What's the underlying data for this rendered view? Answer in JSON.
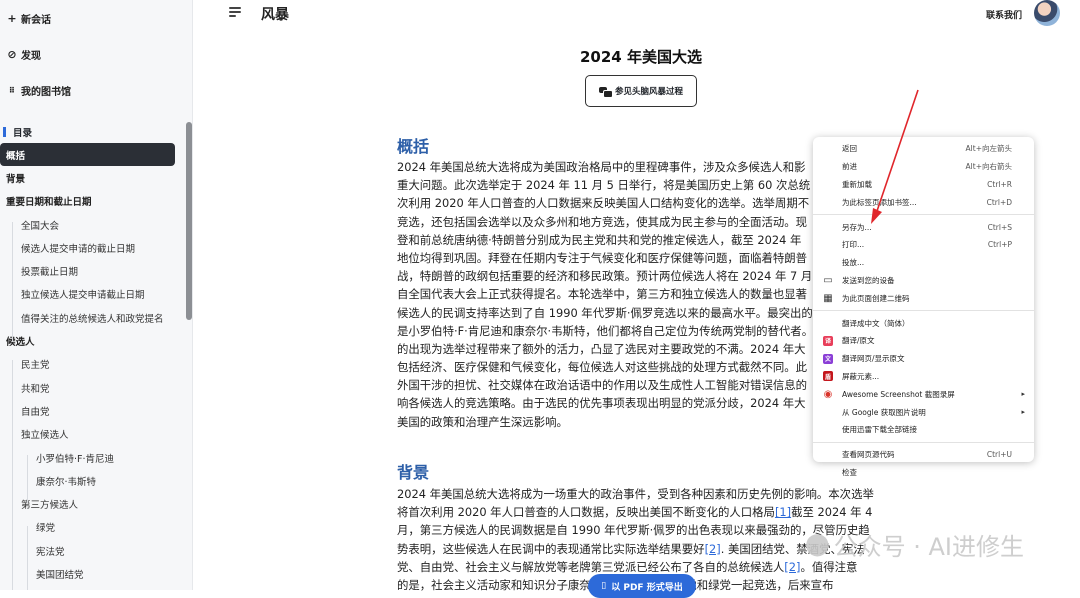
{
  "sidebar": {
    "new_chat": "新会话",
    "discover": "发现",
    "library": "我的图书馆",
    "toc_title": "目录",
    "toc": [
      {
        "label": "概括",
        "level": 1,
        "active": true
      },
      {
        "label": "背景",
        "level": 1
      },
      {
        "label": "重要日期和截止日期",
        "level": 1
      },
      {
        "label": "全国大会",
        "level": 2
      },
      {
        "label": "候选人提交申请的截止日期",
        "level": 2
      },
      {
        "label": "投票截止日期",
        "level": 2
      },
      {
        "label": "独立候选人提交申请截止日期",
        "level": 2
      },
      {
        "label": "值得关注的总统候选人和政党提名",
        "level": 2
      },
      {
        "label": "候选人",
        "level": 1
      },
      {
        "label": "民主党",
        "level": 2
      },
      {
        "label": "共和党",
        "level": 2
      },
      {
        "label": "自由党",
        "level": 2
      },
      {
        "label": "独立候选人",
        "level": 2
      },
      {
        "label": "小罗伯特·F·肯尼迪",
        "level": 3
      },
      {
        "label": "康奈尔·韦斯特",
        "level": 3
      },
      {
        "label": "第三方候选人",
        "level": 2
      },
      {
        "label": "绿党",
        "level": 3
      },
      {
        "label": "宪法党",
        "level": 3
      },
      {
        "label": "美国团结党",
        "level": 3
      }
    ]
  },
  "header": {
    "brand": "风暴",
    "contact": "联系我们"
  },
  "doc": {
    "title": "2024 年美国大选",
    "mindmap_button": "参见头脑风暴过程",
    "section1_title": "概括",
    "section1_lines": [
      "2024 年美国总统大选将成为美国政治格局中的里程碑事件，涉及众多候选人和影",
      "重大问题。此次选举定于 2024 年 11 月 5 日举行，将是美国历史上第 60 次总统",
      "次利用 2020 年人口普查的人口数据来反映美国人口结构变化的选举。选举周期不",
      "竞选，还包括国会选举以及众多州和地方竞选，使其成为民主参与的全面活动。现",
      "登和前总统唐纳德·特朗普分别成为民主党和共和党的推定候选人，截至 2024 年",
      "地位均得到巩固。拜登在任期内专注于气候变化和医疗保健等问题，面临着特朗普",
      "战，特朗普的政纲包括重要的经济和移民政策。预计两位候选人将在 2024 年 7 月",
      "自全国代表大会上正式获得提名。本轮选举中，第三方和独立候选人的数量也显著",
      "候选人的民调支持率达到了自 1990 年代罗斯·佩罗竞选以来的最高水平。最突出的",
      "是小罗伯特·F·肯尼迪和康奈尔·韦斯特，他们都将自己定位为传统两党制的替代者。",
      "的出现为选举过程带来了额外的活力，凸显了选民对主要政党的不满。2024 年大",
      "包括经济、医疗保健和气候变化，每位候选人对这些挑战的处理方式截然不同。此",
      "外国干涉的担忧、社交媒体在政治话语中的作用以及生成性人工智能对错误信息的",
      "响各候选人的竞选策略。由于选民的优先事项表现出明显的党派分歧，2024 年大",
      "美国的政策和治理产生深远影响。"
    ],
    "section2_title": "背景",
    "section2_lines": [
      {
        "pre": "2024 年美国总统大选将成为一场重大的政治事件，受到各种因素和历史先例的影响。本次选举",
        "link": "",
        "post": ""
      },
      {
        "pre": "将首次利用 2020 年人口普查的人口数据，反映出美国不断变化的人口格局",
        "link": "[1]",
        "post": "截至 2024 年 4"
      },
      {
        "pre": "月，第三方候选人的民调数据是自 1990 年代罗斯·佩罗的出色表现以来最强劲的，尽管历史趋",
        "link": "",
        "post": ""
      },
      {
        "pre": "势表明，这些候选人在民调中的表现通常比实际选举结果要好",
        "link": "[2]",
        "post": ". 美国团结党、禁酒党、宪法"
      },
      {
        "pre": "党、自由党、社会主义与解放党等老牌第三党派已经公布了各自的总统候选人",
        "link": "[2]",
        "post": "。值得注意"
      },
      {
        "pre": "的是，社会主义活动家和知识分子康奈尔·韦斯特将与人民党和绿党一起竞选，后来宣布",
        "link": "",
        "post": ""
      }
    ],
    "pdf_button": "以 PDF 形式导出"
  },
  "context_menu": {
    "items": [
      {
        "label": "返回",
        "shortcut": "Alt+向左箭头"
      },
      {
        "label": "前进",
        "shortcut": "Alt+向右箭头"
      },
      {
        "label": "重新加载",
        "shortcut": "Ctrl+R"
      },
      {
        "label": "为此标签页添加书签...",
        "shortcut": "Ctrl+D"
      },
      {
        "sep": true
      },
      {
        "label": "另存为...",
        "shortcut": "Ctrl+S"
      },
      {
        "label": "打印...",
        "shortcut": "Ctrl+P"
      },
      {
        "label": "投放...",
        "shortcut": ""
      },
      {
        "label": "发送到您的设备",
        "shortcut": "",
        "icon": "device-icon"
      },
      {
        "label": "为此页面创建二维码",
        "shortcut": "",
        "icon": "qr-icon"
      },
      {
        "sep": true
      },
      {
        "label": "翻译成中文（简体）",
        "shortcut": ""
      },
      {
        "label": "翻译/原文",
        "shortcut": "",
        "icon": "translate-icon"
      },
      {
        "label": "翻译网页/显示原文",
        "shortcut": "",
        "icon": "translate-page-icon"
      },
      {
        "label": "屏蔽元素...",
        "shortcut": "",
        "icon": "adblock-icon"
      },
      {
        "label": "Awesome Screenshot 截图录屏",
        "shortcut": "",
        "icon": "screenshot-icon",
        "submenu": true
      },
      {
        "label": "从 Google 获取图片说明",
        "shortcut": "",
        "submenu": true
      },
      {
        "label": "使用迅雷下载全部链接",
        "shortcut": ""
      },
      {
        "sep": true
      },
      {
        "label": "查看网页源代码",
        "shortcut": "Ctrl+U"
      },
      {
        "label": "检查",
        "shortcut": ""
      }
    ]
  },
  "watermark": "公众号 · AI进修生",
  "colors": {
    "accent": "#2d6ad9",
    "heading": "#2d5fa8",
    "active_toc": "#2b2f36",
    "arrow": "#e0262b"
  }
}
